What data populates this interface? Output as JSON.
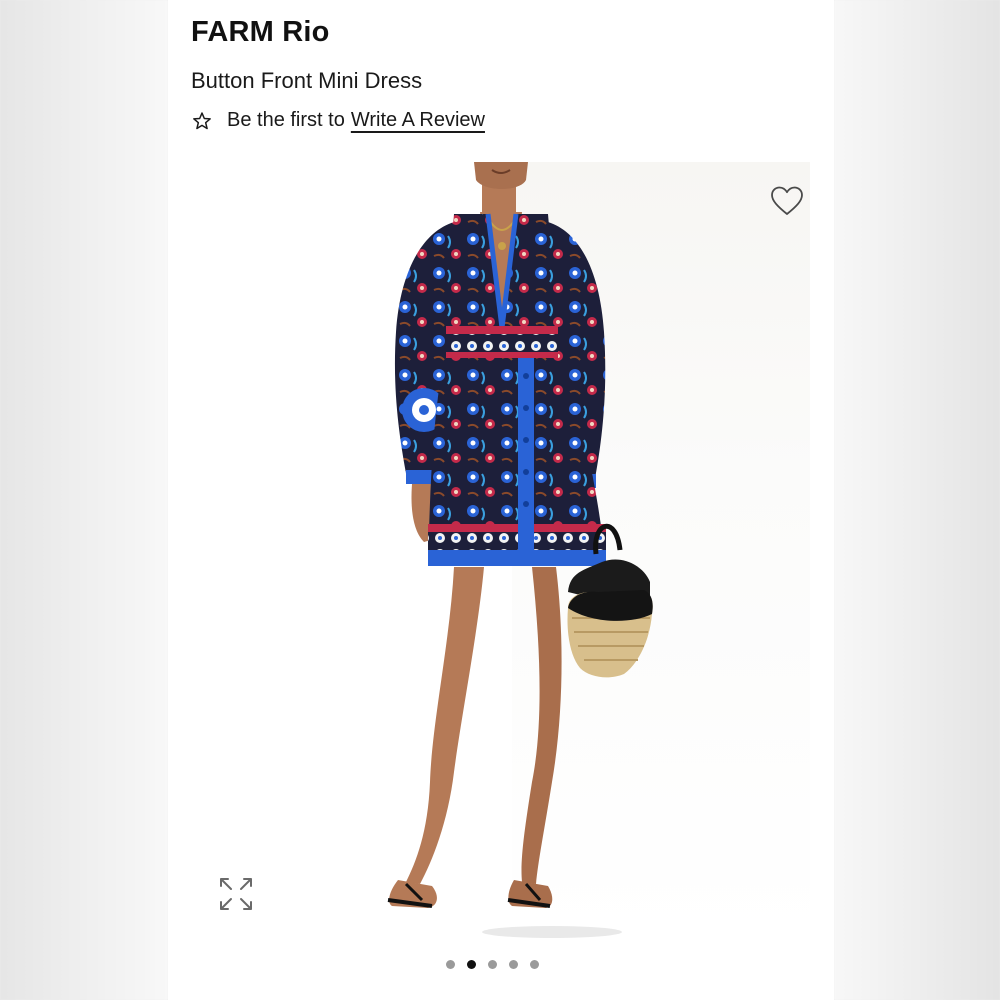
{
  "product": {
    "brand": "FARM Rio",
    "name": "Button Front Mini Dress"
  },
  "reviews": {
    "prompt": "Be the first to",
    "link_label": "Write A Review"
  },
  "gallery": {
    "image_alt": "Model wearing Button Front Mini Dress",
    "total_images": 5,
    "active_index": 1
  },
  "icons": {
    "review": "star-outline-icon",
    "favorite": "heart-outline-icon",
    "zoom": "expand-arrows-icon"
  },
  "colors": {
    "text": "#111111",
    "dot_active": "#111111",
    "dot_inactive": "#9a9a9a",
    "dress_base": "#1d1f3a",
    "dress_blue": "#2a63d6",
    "dress_red": "#c42a4a"
  }
}
